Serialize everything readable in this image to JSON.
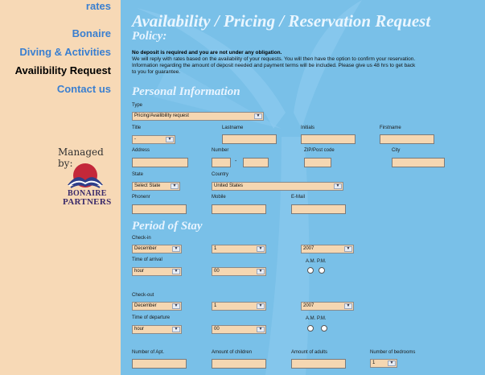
{
  "sidebar": {
    "items": [
      {
        "label": "rates"
      },
      {
        "label": "Bonaire"
      },
      {
        "label": "Diving & Activities"
      },
      {
        "label": "Availibility Request",
        "active": true
      },
      {
        "label": "Contact us"
      }
    ],
    "managed_by": "Managed by:",
    "logo_text_1": "BONAIRE",
    "logo_text_2": "PARTNERS"
  },
  "page": {
    "title": "Availability / Pricing / Reservation Request",
    "policy_heading": "Policy:",
    "policy_bold": "No deposit is required and you are not under any obligation.",
    "policy_lines": [
      "We will reply with rates based on the availability of your requests. You will then have the option to confirm your reservation.",
      "Information regarding the amount of deposit needed and payment terms will be included. Please give us 48 hrs to get back",
      "to you for guarantee."
    ]
  },
  "personal": {
    "heading": "Personal Information",
    "type_label": "Type",
    "type_value": "Pricing/Availibility request",
    "title_label": "Title",
    "title_value": "-",
    "lastname_label": "Lastname",
    "initials_label": "Initials",
    "firstname_label": "Firstname",
    "address_label": "Address",
    "number_label": "Number",
    "zip_label": "ZIP/Post code",
    "city_label": "City",
    "state_label": "State",
    "state_value": "Select State",
    "country_label": "Country",
    "country_value": "United States",
    "phone_label": "Phonenr",
    "mobile_label": "Mobile",
    "email_label": "E-Mail"
  },
  "stay": {
    "heading": "Period of Stay",
    "checkin_label": "Check-in",
    "checkin_month": "December",
    "checkin_day": "1",
    "checkin_year": "2007",
    "arrival_label": "Time of arrival",
    "arrival_hour": "hour",
    "arrival_min": "00",
    "arrival_ampm": "A.M. P.M.",
    "checkout_label": "Check-out",
    "checkout_month": "December",
    "checkout_day": "1",
    "checkout_year": "2007",
    "departure_label": "Time of departure",
    "departure_hour": "hour",
    "departure_min": "00",
    "departure_ampm": "A.M.  P.M.",
    "apt_label": "Number of Apt.",
    "children_label": "Amount of children",
    "adults_label": "Amount of adults",
    "bedrooms_label": "Number of bedrooms",
    "bedrooms_value": "1"
  },
  "colors": {
    "sidebar_bg": "#f7d9b6",
    "main_bg": "#79c0e8",
    "nav_link": "#3a7fd0",
    "field_bg": "#f5d7b2"
  }
}
